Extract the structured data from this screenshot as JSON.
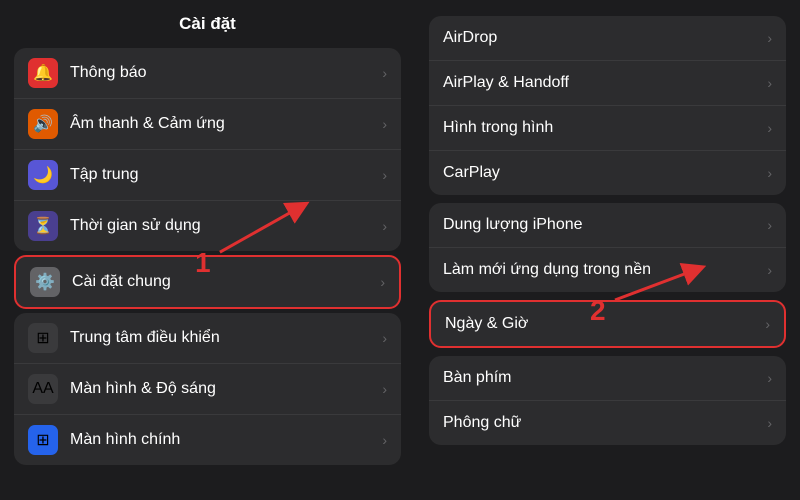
{
  "left": {
    "title": "Cài đặt",
    "groups": [
      {
        "id": "group1",
        "highlighted": false,
        "items": [
          {
            "id": "notifications",
            "icon": "🔔",
            "iconColor": "icon-red",
            "label": "Thông báo",
            "chevron": "›"
          },
          {
            "id": "sounds",
            "icon": "🔊",
            "iconColor": "icon-orange",
            "label": "Âm thanh & Cảm ứng",
            "chevron": "›"
          },
          {
            "id": "focus",
            "icon": "🌙",
            "iconColor": "icon-purple",
            "label": "Tập trung",
            "chevron": "›"
          },
          {
            "id": "screentime",
            "icon": "⏳",
            "iconColor": "icon-indigo",
            "label": "Thời gian sử dụng",
            "chevron": "›"
          }
        ]
      },
      {
        "id": "group2",
        "highlighted": true,
        "items": [
          {
            "id": "general",
            "icon": "⚙️",
            "iconColor": "icon-gray",
            "label": "Cài đặt chung",
            "chevron": "›"
          }
        ]
      },
      {
        "id": "group3",
        "highlighted": false,
        "items": [
          {
            "id": "controlcenter",
            "icon": "⊞",
            "iconColor": "icon-dark",
            "label": "Trung tâm điều khiển",
            "chevron": "›"
          },
          {
            "id": "display",
            "icon": "AA",
            "iconColor": "icon-dark",
            "label": "Màn hình & Độ sáng",
            "chevron": "›"
          },
          {
            "id": "homescreen",
            "icon": "⊞",
            "iconColor": "icon-blue",
            "label": "Màn hình chính",
            "chevron": "›"
          }
        ]
      }
    ],
    "marker": "1"
  },
  "right": {
    "groups": [
      {
        "id": "rgroup1",
        "highlighted": false,
        "items": [
          {
            "id": "airdrop",
            "label": "AirDrop",
            "chevron": "›"
          },
          {
            "id": "airplay",
            "label": "AirPlay & Handoff",
            "chevron": "›"
          },
          {
            "id": "pip",
            "label": "Hình trong hình",
            "chevron": "›"
          },
          {
            "id": "carplay",
            "label": "CarPlay",
            "chevron": "›"
          }
        ]
      },
      {
        "id": "rgroup2",
        "highlighted": false,
        "items": [
          {
            "id": "storage",
            "label": "Dung lượng iPhone",
            "chevron": "›"
          },
          {
            "id": "bgrefresh",
            "label": "Làm mới ứng dụng trong nền",
            "chevron": "›"
          }
        ]
      },
      {
        "id": "rgroup3",
        "highlighted": true,
        "items": [
          {
            "id": "datetime",
            "label": "Ngày & Giờ",
            "chevron": "›"
          }
        ]
      },
      {
        "id": "rgroup4",
        "highlighted": false,
        "items": [
          {
            "id": "keyboard",
            "label": "Bàn phím",
            "chevron": "›"
          },
          {
            "id": "font",
            "label": "Phông chữ",
            "chevron": "›"
          }
        ]
      }
    ],
    "marker": "2"
  }
}
